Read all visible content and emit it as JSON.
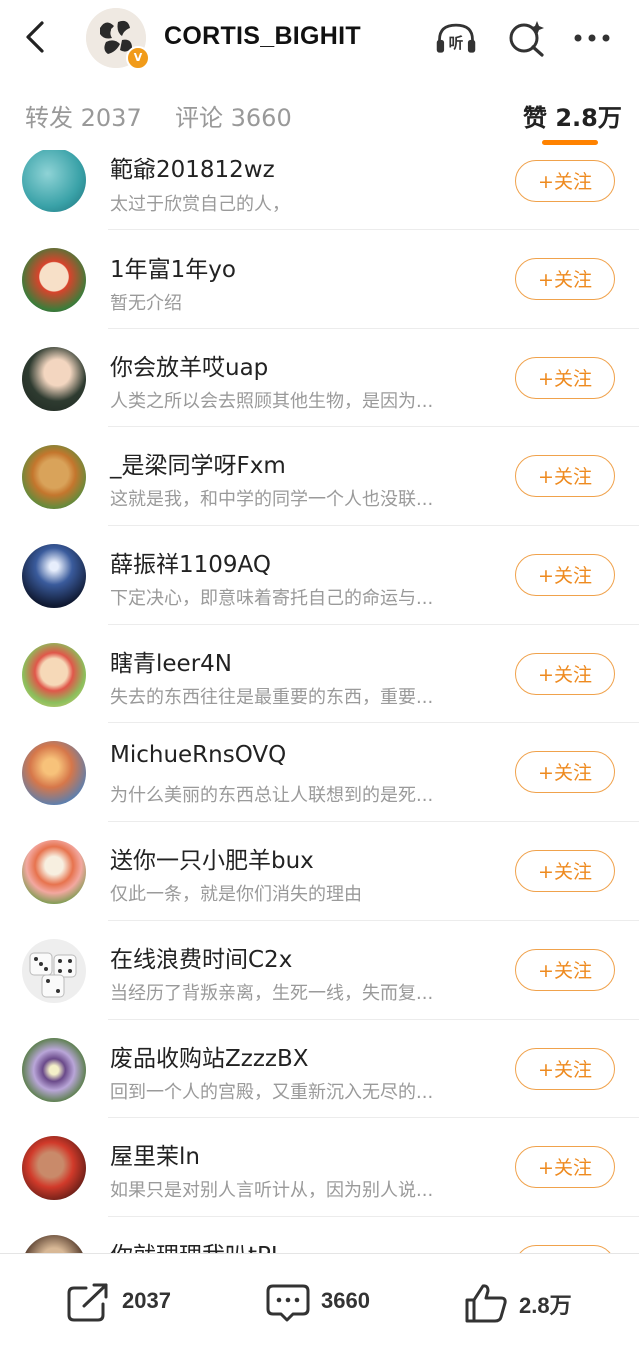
{
  "header": {
    "title": "CORTIS_BIGHIT",
    "verified_badge": "V",
    "icons": [
      "back-icon",
      "listen-icon",
      "search-icon",
      "more-icon"
    ],
    "listen_label": "听"
  },
  "tabs": [
    {
      "label": "转发",
      "count": "2037"
    },
    {
      "label": "评论",
      "count": "3660"
    },
    {
      "label": "赞",
      "count": "2.8万",
      "active": true
    }
  ],
  "follow_label": "+关注",
  "users": [
    {
      "name": "範爺201812wz",
      "desc": "太过于欣赏自己的人，"
    },
    {
      "name": "1年富1年yo",
      "desc": "暂无介绍"
    },
    {
      "name": "你会放羊哎uap",
      "desc": "人类之所以会去照顾其他生物，是因为..."
    },
    {
      "name": "_是梁同学呀Fxm",
      "desc": "这就是我，和中学的同学一个人也没联..."
    },
    {
      "name": "薛振祥1109AQ",
      "desc": "下定决心，即意味着寄托自己的命运与..."
    },
    {
      "name": "瞎青leer4N",
      "desc": "失去的东西往往是最重要的东西，重要..."
    },
    {
      "name": "MichueRnsOVQ",
      "desc": "为什么美丽的东西总让人联想到的是死..."
    },
    {
      "name": "送你一只小肥羊bux",
      "desc": "仅此一条，就是你们消失的理由"
    },
    {
      "name": "在线浪费时间C2x",
      "desc": "当经历了背叛亲离，生死一线，失而复..."
    },
    {
      "name": "废品收购站ZzzzBX",
      "desc": "回到一个人的宫殿，又重新沉入无尽的..."
    },
    {
      "name": "屋里茉ln",
      "desc": "如果只是对别人言听计从，因为别人说..."
    },
    {
      "name": "你就理理我叭tPJ",
      "desc": ""
    }
  ],
  "bottom_bar": {
    "repost_count": "2037",
    "comment_count": "3660",
    "like_count": "2.8万"
  },
  "colors": {
    "accent": "#ff8200",
    "follow_border": "#f0a24c"
  }
}
